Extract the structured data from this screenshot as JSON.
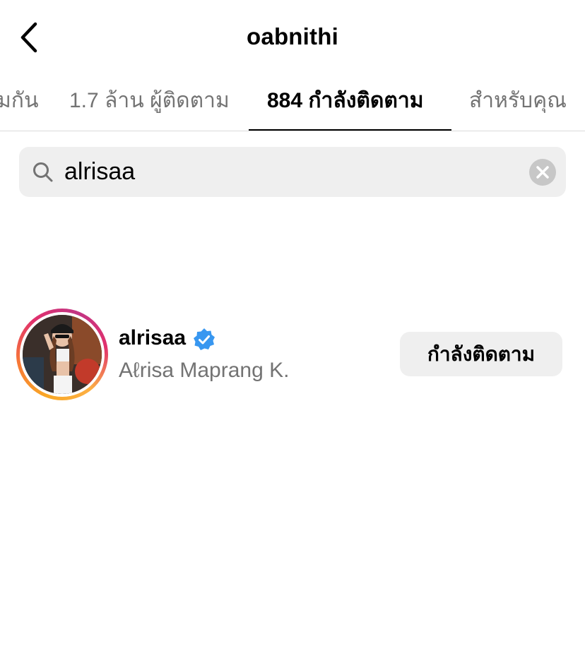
{
  "header": {
    "title": "oabnithi"
  },
  "tabs": [
    {
      "label": "มกัน"
    },
    {
      "label": "1.7 ล้าน ผู้ติดตาม"
    },
    {
      "label": "884 กำลังติดตาม",
      "active": true
    },
    {
      "label": "สำหรับคุณ"
    }
  ],
  "search": {
    "value": "alrisaa",
    "icon": "search-icon",
    "clear_icon": "clear-icon"
  },
  "results": [
    {
      "username": "alrisaa",
      "verified": true,
      "full_name": "Aℓrisa Maprang K.",
      "button_label": "กำลังติดตาม"
    }
  ],
  "colors": {
    "accent_verified": "#3897f0",
    "secondary_text": "#737373",
    "button_bg": "#efefef"
  }
}
